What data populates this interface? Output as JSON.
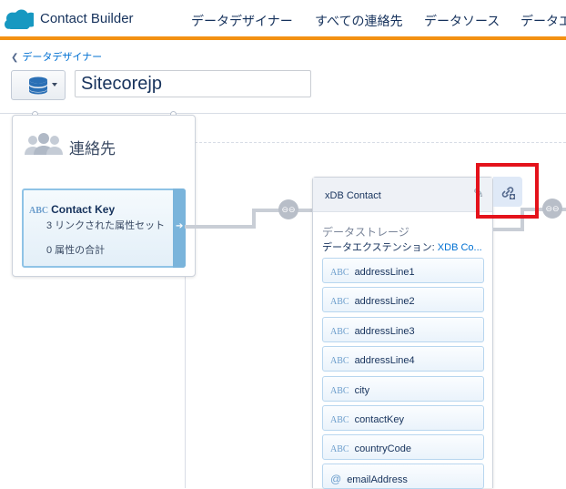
{
  "header": {
    "app_title": "Contact Builder",
    "brand_color": "#1798c1",
    "accent_color": "#f39112",
    "nav": [
      "データデザイナー",
      "すべての連絡先",
      "データソース",
      "データエ"
    ]
  },
  "breadcrumb": {
    "label": "データデザイナー"
  },
  "toolbar": {
    "db_icon": "database-icon",
    "name_value": "Sitecorejp"
  },
  "contact_card": {
    "title": "連絡先",
    "icon": "people-icon",
    "key": {
      "type_label": "ABC",
      "title": "Contact Key",
      "linked": "3 リンクされた属性セット",
      "total": "0 属性の合計"
    }
  },
  "link_badge_label": "⊖⊖",
  "entity": {
    "title": "xDB Contact",
    "storage_label": "データストレージ",
    "extension_label": "データエクステンション:",
    "extension_value": "XDB Co...",
    "fields": [
      {
        "type": "ABC",
        "name": "addressLine1"
      },
      {
        "type": "ABC",
        "name": "addressLine2"
      },
      {
        "type": "ABC",
        "name": "addressLine3"
      },
      {
        "type": "ABC",
        "name": "addressLine4"
      },
      {
        "type": "ABC",
        "name": "city"
      },
      {
        "type": "ABC",
        "name": "contactKey"
      },
      {
        "type": "ABC",
        "name": "countryCode"
      },
      {
        "type": "@",
        "name": "emailAddress"
      }
    ]
  },
  "highlight_color": "#e4121b"
}
